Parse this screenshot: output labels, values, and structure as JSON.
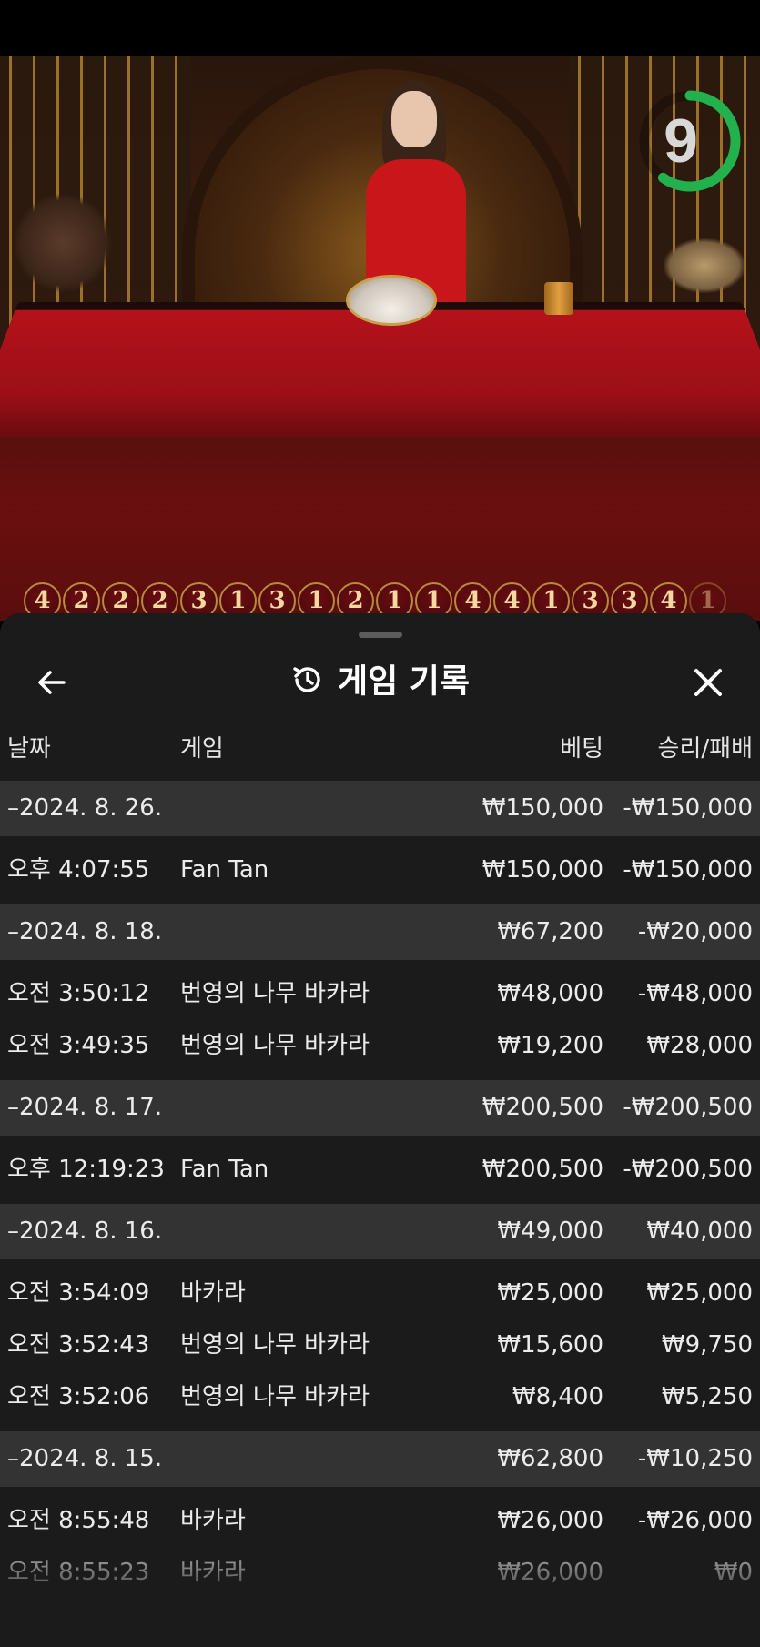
{
  "timer": {
    "value": "9",
    "progress": 0.6,
    "color": "#22b14c"
  },
  "road": [
    "4",
    "2",
    "2",
    "2",
    "3",
    "1",
    "3",
    "1",
    "2",
    "1",
    "1",
    "4",
    "4",
    "1",
    "3",
    "3",
    "4",
    "1"
  ],
  "sheet": {
    "title": "게임 기록",
    "back_icon": "arrow-left-icon",
    "history_icon": "history-icon",
    "close_icon": "close-icon",
    "columns": {
      "date": "날짜",
      "game": "게임",
      "bet": "베팅",
      "result": "승리/패배"
    },
    "groups": [
      {
        "date": "–2024. 8. 26.",
        "bet": "₩150,000",
        "result": "-₩150,000",
        "rows": [
          {
            "time": "오후 4:07:55",
            "game": "Fan Tan",
            "bet": "₩150,000",
            "result": "-₩150,000"
          }
        ]
      },
      {
        "date": "–2024. 8. 18.",
        "bet": "₩67,200",
        "result": "-₩20,000",
        "rows": [
          {
            "time": "오전 3:50:12",
            "game": "번영의 나무 바카라",
            "bet": "₩48,000",
            "result": "-₩48,000"
          },
          {
            "time": "오전 3:49:35",
            "game": "번영의 나무 바카라",
            "bet": "₩19,200",
            "result": "₩28,000"
          }
        ]
      },
      {
        "date": "–2024. 8. 17.",
        "bet": "₩200,500",
        "result": "-₩200,500",
        "rows": [
          {
            "time": "오후 12:19:23",
            "game": "Fan Tan",
            "bet": "₩200,500",
            "result": "-₩200,500"
          }
        ]
      },
      {
        "date": "–2024. 8. 16.",
        "bet": "₩49,000",
        "result": "₩40,000",
        "rows": [
          {
            "time": "오전 3:54:09",
            "game": "바카라",
            "bet": "₩25,000",
            "result": "₩25,000"
          },
          {
            "time": "오전 3:52:43",
            "game": "번영의 나무 바카라",
            "bet": "₩15,600",
            "result": "₩9,750"
          },
          {
            "time": "오전 3:52:06",
            "game": "번영의 나무 바카라",
            "bet": "₩8,400",
            "result": "₩5,250"
          }
        ]
      },
      {
        "date": "–2024. 8. 15.",
        "bet": "₩62,800",
        "result": "-₩10,250",
        "rows": [
          {
            "time": "오전 8:55:48",
            "game": "바카라",
            "bet": "₩26,000",
            "result": "-₩26,000"
          },
          {
            "time": "오전 8:55:23",
            "game": "바카라",
            "bet": "₩26,000",
            "result": "₩0"
          }
        ]
      }
    ]
  }
}
